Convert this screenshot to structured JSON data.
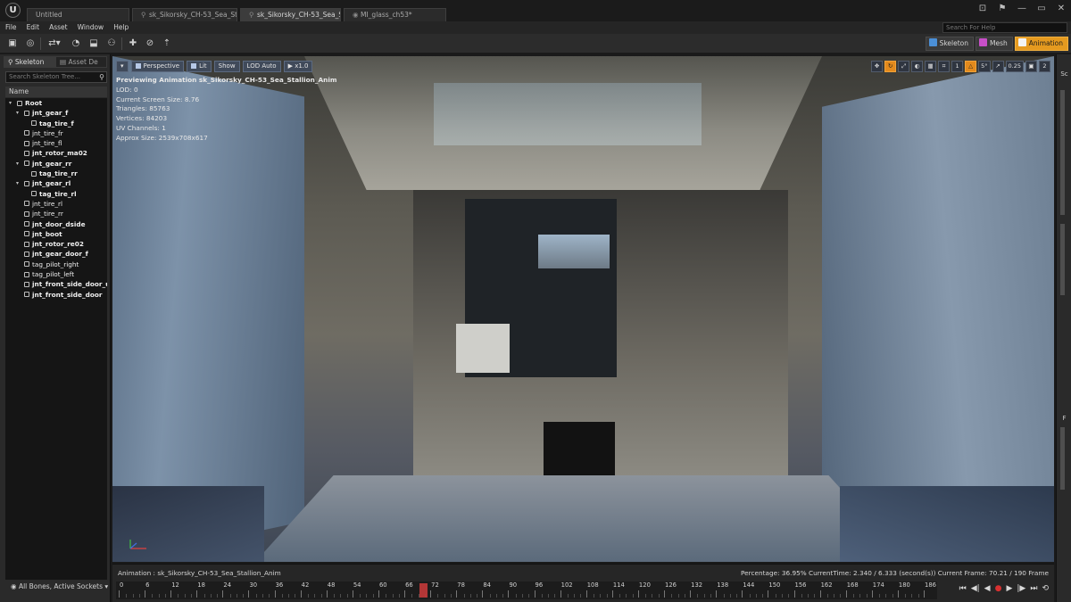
{
  "window": {
    "tabs": [
      {
        "label": "Untitled"
      },
      {
        "label": "sk_Sikorsky_CH-53_Sea_St"
      },
      {
        "label": "sk_Sikorsky_CH-53_Sea_St"
      },
      {
        "label": "MI_glass_ch53*"
      }
    ],
    "controls": [
      "⊡",
      "⚑",
      "—",
      "▭",
      "✕"
    ]
  },
  "menu": {
    "items": [
      "File",
      "Edit",
      "Asset",
      "Window",
      "Help"
    ],
    "search_placeholder": "Search For Help"
  },
  "modes": {
    "skeleton": "Skeleton",
    "mesh": "Mesh",
    "animation": "Animation",
    "active": "Animation",
    "accent_color": "#e59a1f"
  },
  "left_panel": {
    "tabs": [
      "Skeleton",
      "Asset De"
    ],
    "search_placeholder": "Search Skeleton Tree...",
    "column_header": "Name",
    "bones": [
      {
        "name": "Root",
        "level": 0,
        "expand": true,
        "bold": true
      },
      {
        "name": "jnt_gear_f",
        "level": 1,
        "expand": true,
        "bold": true
      },
      {
        "name": "tag_tire_f",
        "level": 2,
        "expand": false,
        "bold": true
      },
      {
        "name": "jnt_tire_fr",
        "level": 1,
        "expand": false,
        "bold": false
      },
      {
        "name": "jnt_tire_fl",
        "level": 1,
        "expand": false,
        "bold": false
      },
      {
        "name": "jnt_rotor_ma02",
        "level": 1,
        "expand": false,
        "bold": true
      },
      {
        "name": "jnt_gear_rr",
        "level": 1,
        "expand": true,
        "bold": true
      },
      {
        "name": "tag_tire_rr",
        "level": 2,
        "expand": false,
        "bold": true
      },
      {
        "name": "jnt_gear_rl",
        "level": 1,
        "expand": true,
        "bold": true
      },
      {
        "name": "tag_tire_rl",
        "level": 2,
        "expand": false,
        "bold": true
      },
      {
        "name": "jnt_tire_rl",
        "level": 1,
        "expand": false,
        "bold": false
      },
      {
        "name": "jnt_tire_rr",
        "level": 1,
        "expand": false,
        "bold": false
      },
      {
        "name": "jnt_door_dside",
        "level": 1,
        "expand": false,
        "bold": true
      },
      {
        "name": "jnt_boot",
        "level": 1,
        "expand": false,
        "bold": true
      },
      {
        "name": "jnt_rotor_re02",
        "level": 1,
        "expand": false,
        "bold": true
      },
      {
        "name": "jnt_gear_door_f",
        "level": 1,
        "expand": false,
        "bold": true
      },
      {
        "name": "tag_pilot_right",
        "level": 1,
        "expand": false,
        "bold": false
      },
      {
        "name": "tag_pilot_left",
        "level": 1,
        "expand": false,
        "bold": false
      },
      {
        "name": "jnt_front_side_door_upp",
        "level": 1,
        "expand": false,
        "bold": true
      },
      {
        "name": "jnt_front_side_door",
        "level": 1,
        "expand": false,
        "bold": true
      }
    ],
    "footer": "All Bones, Active Sockets"
  },
  "viewport": {
    "buttons": {
      "menu": "▾",
      "perspective": "Perspective",
      "lit": "Lit",
      "show": "Show",
      "lod": "LOD Auto",
      "speed": "x1.0"
    },
    "right_tools": [
      "✥",
      "↻",
      "⤢",
      "◐",
      "▦",
      "⌗",
      "1",
      "△",
      "5°",
      "↗",
      "0.25",
      "▣",
      "2"
    ],
    "stats": {
      "preview": "Previewing Animation sk_Sikorsky_CH-53_Sea_Stallion_Anim",
      "lod": "LOD: 0",
      "screen_size": "Current Screen Size: 8.76",
      "triangles": "Triangles: 85763",
      "vertices": "Vertices: 84203",
      "uv": "UV Channels: 1",
      "approx": "Approx Size: 2539x708x617"
    }
  },
  "right_strip": {
    "top": "Sc",
    "mid": "F"
  },
  "timeline": {
    "animation_label": "Animation :",
    "animation_name": "sk_Sikorsky_CH-53_Sea_Stallion_Anim",
    "percentage": "Percentage:  36.95%",
    "current_time": "CurrentTime:  2.340 / 6.333 (second(s))",
    "current_frame": "Current Frame:  70.21 / 190 Frame",
    "ticks": [
      "0",
      "6",
      "12",
      "18",
      "24",
      "30",
      "36",
      "42",
      "48",
      "54",
      "60",
      "66",
      "72",
      "78",
      "84",
      "90",
      "96",
      "102",
      "108",
      "114",
      "120",
      "126",
      "132",
      "138",
      "144",
      "150",
      "156",
      "162",
      "168",
      "174",
      "180",
      "186"
    ],
    "progress": 0.3695,
    "controls": [
      "⏮",
      "◀|",
      "◀",
      "●",
      "▶",
      "|▶",
      "⏭",
      "⟲"
    ]
  }
}
